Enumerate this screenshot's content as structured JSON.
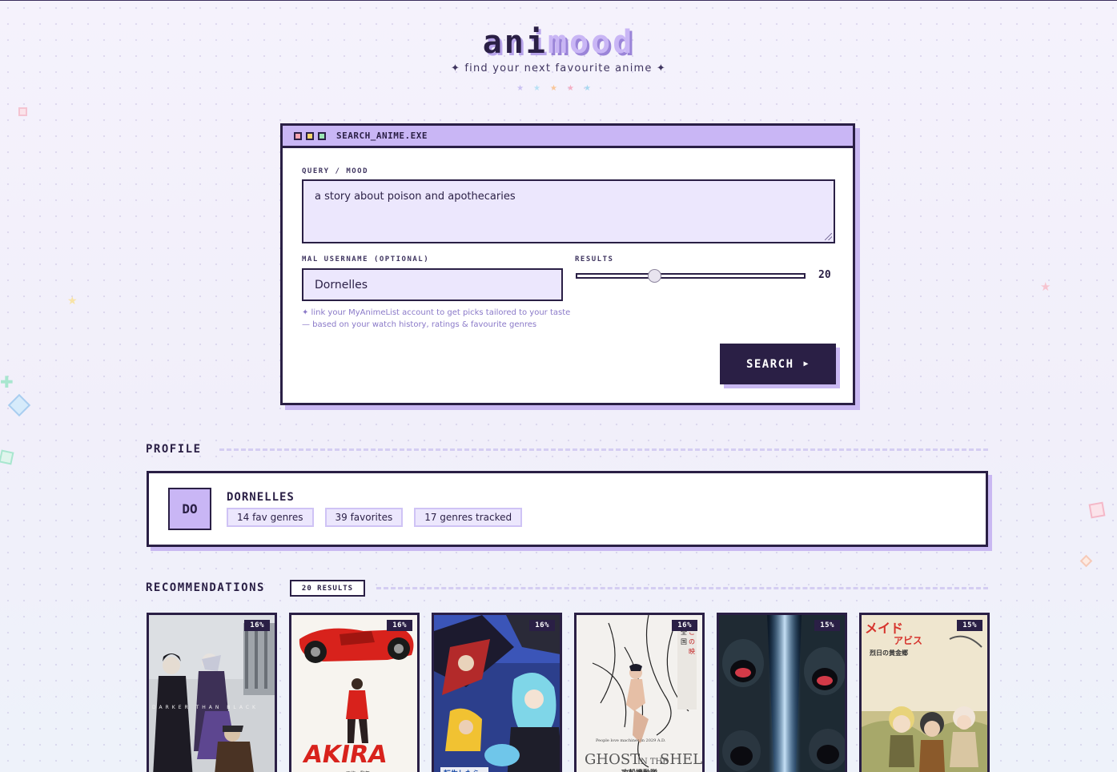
{
  "header": {
    "logo_part1": "ani",
    "logo_part2": "mood",
    "tagline": "✦ find your next favourite anime ✦",
    "stars": "★★★★★"
  },
  "search_window": {
    "title": "SEARCH_ANIME.EXE",
    "query_label": "QUERY / MOOD",
    "query_value": "a story about poison and apothecaries",
    "username_label": "MAL USERNAME (OPTIONAL)",
    "username_value": "Dornelles",
    "results_label": "RESULTS",
    "results_count": "20",
    "slider_fraction": 0.34,
    "hint_line1": "✦ link your MyAnimeList account to get picks tailored to your taste",
    "hint_line2": "— based on your watch history, ratings & favourite genres",
    "search_button": "SEARCH",
    "search_arrow": "▶"
  },
  "profile": {
    "section_title": "PROFILE",
    "avatar_initials": "DO",
    "name": "DORNELLES",
    "chips": [
      "14 fav genres",
      "39 favorites",
      "17 genres tracked"
    ]
  },
  "recommendations": {
    "section_title": "RECOMMENDATIONS",
    "results_badge": "20 RESULTS",
    "cards": [
      {
        "match": "16%",
        "poster_text": "DARKER THAN BLACK"
      },
      {
        "match": "16%",
        "poster_text": "AKIRA"
      },
      {
        "match": "16%",
        "poster_text": "転生したら スライム"
      },
      {
        "match": "16%",
        "poster_text": "GHOST IN THE SHELL"
      },
      {
        "match": "15%",
        "poster_text": ""
      },
      {
        "match": "15%",
        "poster_text": "メイドインアビス"
      }
    ]
  },
  "colors": {
    "ink": "#2a1f45",
    "lavender": "#c9b6f5",
    "field_bg": "#ece7fd",
    "shadow": "#c9b8f2",
    "hint": "#8a79c8",
    "dot_red": "#f7a3b1",
    "dot_yellow": "#f8d66b",
    "dot_green": "#9ae6b4"
  }
}
